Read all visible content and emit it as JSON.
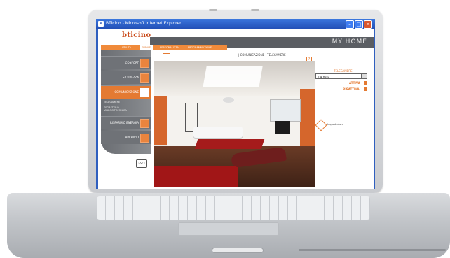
{
  "browser": {
    "window_title": "BTicino - Microsoft Internet Explorer",
    "icon": "ie-icon",
    "controls": [
      "minimize",
      "maximize",
      "close"
    ]
  },
  "site": {
    "logo": "bticino",
    "section_title": "MY HOME",
    "tabs": [
      "UTILITÀ",
      "SERVIZI",
      "PERSONALIZZA",
      "PROGRAMMAZIONE"
    ],
    "active_tab": "SERVIZI"
  },
  "sidebar": {
    "items": [
      {
        "label": "CONFORT",
        "icon": "grid-icon"
      },
      {
        "label": "SICUREZZA",
        "icon": "shield-icon"
      },
      {
        "label": "COMUNICAZIONE",
        "icon": "camera-icon",
        "active": true
      },
      {
        "label": "RISPARMIO ENERGIA",
        "icon": "energy-icon"
      },
      {
        "label": "ARCHIVIO",
        "icon": "archive-icon"
      }
    ],
    "sub_items": [
      "TELECAMERE",
      "SEGRETERIA VIDEOCITOFONICA"
    ],
    "exit_label": "ESCI"
  },
  "content": {
    "breadcrumb": "| COMUNICAZIONE | TELECAMERE",
    "help_label": "?",
    "camera_panel_title": "TELECAMERE",
    "camera_select_value": "Ingresso",
    "activate_label": "ATTIVA",
    "deactivate_label": "DISATTIVA",
    "joystick_label": "Inquadratura"
  },
  "colors": {
    "accent": "#e47a32",
    "titlebar": "#2f5fbf",
    "panel_gray": "#6f7277"
  }
}
